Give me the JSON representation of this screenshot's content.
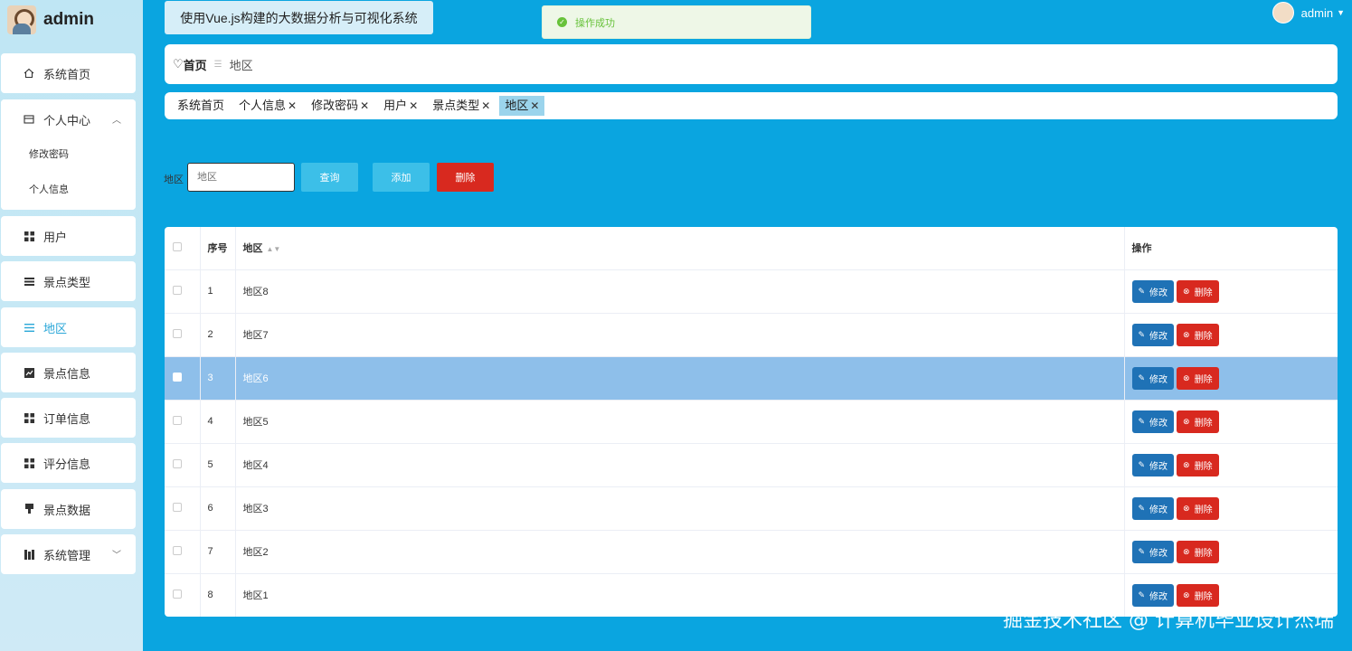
{
  "brand": {
    "name": "admin"
  },
  "sidebar": {
    "items": [
      {
        "label": "系统首页",
        "icon": "home-icon"
      },
      {
        "label": "个人中心",
        "icon": "card-icon",
        "expanded": true
      },
      {
        "label": "用户",
        "icon": "grid-icon"
      },
      {
        "label": "景点类型",
        "icon": "list-icon"
      },
      {
        "label": "地区",
        "icon": "menu-icon",
        "active": true
      },
      {
        "label": "景点信息",
        "icon": "chart-icon"
      },
      {
        "label": "订单信息",
        "icon": "grid-icon"
      },
      {
        "label": "评分信息",
        "icon": "grid-icon"
      },
      {
        "label": "景点数据",
        "icon": "pin-icon"
      },
      {
        "label": "系统管理",
        "icon": "book-icon"
      }
    ],
    "submenu": [
      {
        "label": "修改密码"
      },
      {
        "label": "个人信息"
      }
    ]
  },
  "header": {
    "app_title": "使用Vue.js构建的大数据分析与可视化系统",
    "toast": "操作成功",
    "username": "admin"
  },
  "breadcrumb": {
    "home": "首页",
    "current": "地区"
  },
  "tabs": [
    {
      "label": "系统首页",
      "closable": false
    },
    {
      "label": "个人信息",
      "closable": true
    },
    {
      "label": "修改密码",
      "closable": true
    },
    {
      "label": "用户",
      "closable": true
    },
    {
      "label": "景点类型",
      "closable": true
    },
    {
      "label": "地区",
      "closable": true,
      "active": true
    }
  ],
  "search": {
    "label": "地区",
    "placeholder": "地区",
    "query_label": "查询",
    "add_label": "添加",
    "delete_label": "删除"
  },
  "table": {
    "headers": {
      "index": "序号",
      "region": "地区",
      "actions": "操作"
    },
    "edit_label": "修改",
    "delete_label": "删除",
    "rows": [
      {
        "index": "1",
        "region": "地区8"
      },
      {
        "index": "2",
        "region": "地区7"
      },
      {
        "index": "3",
        "region": "地区6",
        "highlighted": true
      },
      {
        "index": "4",
        "region": "地区5"
      },
      {
        "index": "5",
        "region": "地区4"
      },
      {
        "index": "6",
        "region": "地区3"
      },
      {
        "index": "7",
        "region": "地区2"
      },
      {
        "index": "8",
        "region": "地区1"
      }
    ]
  },
  "watermark": "掘金技术社区 @ 计算机毕业设计杰瑞",
  "colors": {
    "background": "#0aa5e0",
    "sidebar": "#bfe6f4",
    "active_menu": "#2aa7d8",
    "edit_button": "#1f72b6",
    "delete_button": "#d8291f",
    "row_highlight": "#8ebfea",
    "success": "#67c23a"
  }
}
